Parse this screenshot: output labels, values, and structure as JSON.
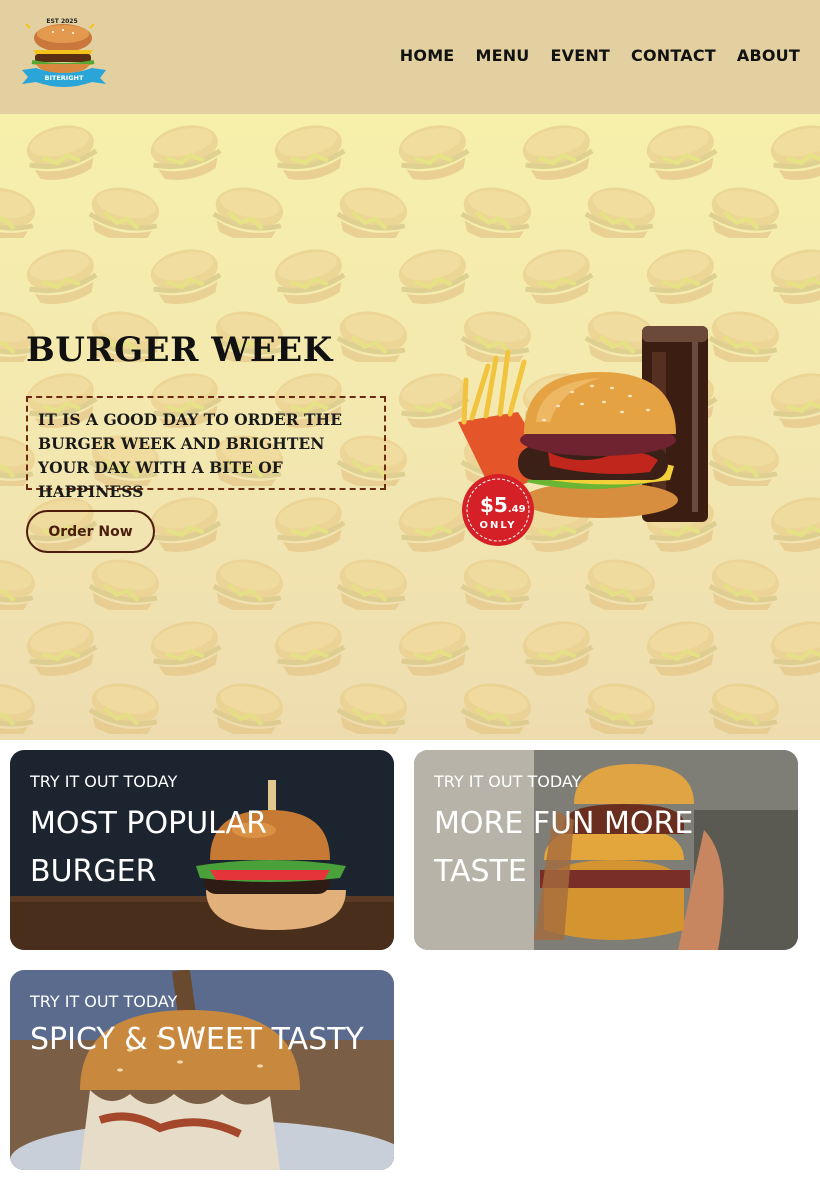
{
  "header": {
    "logo": {
      "top_text": "EST 2025",
      "ribbon_text": "BITERIGHT"
    },
    "nav": [
      "HOME",
      "MENU",
      "EVENT",
      "CONTACT",
      "ABOUT"
    ]
  },
  "hero": {
    "title": "BURGER WEEK",
    "description": "IT IS A GOOD DAY TO ORDER THE BURGER WEEK AND BRIGHTEN YOUR DAY WITH A BITE OF HAPPINESS",
    "cta": "Order Now",
    "price_badge": {
      "dollars": "$5",
      "cents": ".49",
      "note": "ONLY"
    }
  },
  "cards": [
    {
      "kicker": "TRY IT OUT TODAY",
      "heading": "MOST POPULAR BURGER"
    },
    {
      "kicker": "TRY IT OUT TODAY",
      "heading": "MORE FUN MORE TASTE"
    },
    {
      "kicker": "TRY IT OUT TODAY",
      "heading": "SPICY & SWEET TASTY"
    }
  ],
  "colors": {
    "header_bg": "#e2d0a1",
    "hero_bg": "#f6f0ab",
    "accent_brown": "#6b2b12",
    "badge_red": "#d62027"
  }
}
